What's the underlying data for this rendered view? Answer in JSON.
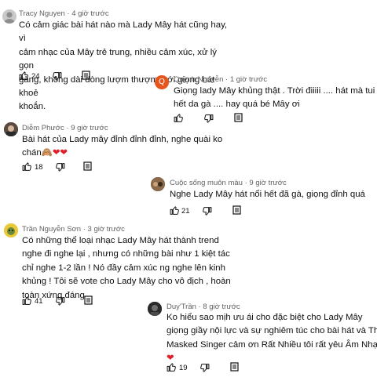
{
  "colors": {
    "meta": "#606060",
    "text": "#0f0f0f",
    "heart": "#e0202a",
    "avatar_q": "#e8551c"
  },
  "comments": [
    {
      "author": "Tracy Nguyen",
      "time": "4 giờ trước",
      "lines": [
        "Có cảm giác bài hát nào mà Lady Mây hát cũng hay, vì",
        "cảm nhạc của Mây trẻ trung, nhiều cảm xúc, xử lý gọn",
        "gàng, không dài dòng lượm thượm, với giọng hát khoẻ",
        "khoắn."
      ],
      "likes": "24",
      "avatar": "default-avatar-icon"
    },
    {
      "author": "Quỳnh Nguyễn",
      "time": "1 giờ trước",
      "avatar_letter": "Q",
      "lines": [
        "Giọng lady Mây khủng thật . Trời điiiii .... hát mà tui nổi",
        "hết da gà .... hay quá bé Mây ơi"
      ],
      "likes": ""
    },
    {
      "author": "Diễm Phước",
      "time": "9 giờ trước",
      "lines": [
        "Bài hát của Lady mây đỉnh đỉnh đỉnh, nghe quài ko",
        "chán"
      ],
      "emoji": "🙈❤❤",
      "likes": "18",
      "avatar": "profile-photo-avatar"
    },
    {
      "author": "Cuộc sống muôn màu",
      "time": "9 giờ trước",
      "lines": [
        "Nghe Lady Mây hát nổi hết đã gà, giọng đỉnh quá"
      ],
      "likes": "21",
      "avatar": "profile-photo-avatar"
    },
    {
      "author": "Trần Nguyễn Sơn",
      "time": "3 giờ trước",
      "lines": [
        "Có những thể loại nhạc Lady Mây hát thành trend",
        "nghe đi nghe lại , nhưng có những bài như 1 kiệt tác",
        "chỉ nghe 1-2 lần ! Nó đầy cảm xúc ng nghe lên kinh",
        "khủng ! Tôi sẽ vote cho Lady Mây cho vô địch , hoàn",
        "toàn xứng đáng"
      ],
      "likes": "41",
      "avatar": "cartoon-avatar"
    },
    {
      "author": "Duy'Trần",
      "time": "8 giờ trước",
      "lines": [
        "Ko hiểu sao mịh ưu ái cho đặc biệt cho Lady Mây",
        "giọng giầy nội lực và sự nghiêm túc cho bài hát và The",
        "Masked Singer cảm ơn Rất Nhiều tôi rất yêu Âm Nhạc"
      ],
      "emoji": "❤",
      "likes": "19",
      "avatar": "profile-photo-avatar"
    }
  ],
  "separator": " · "
}
